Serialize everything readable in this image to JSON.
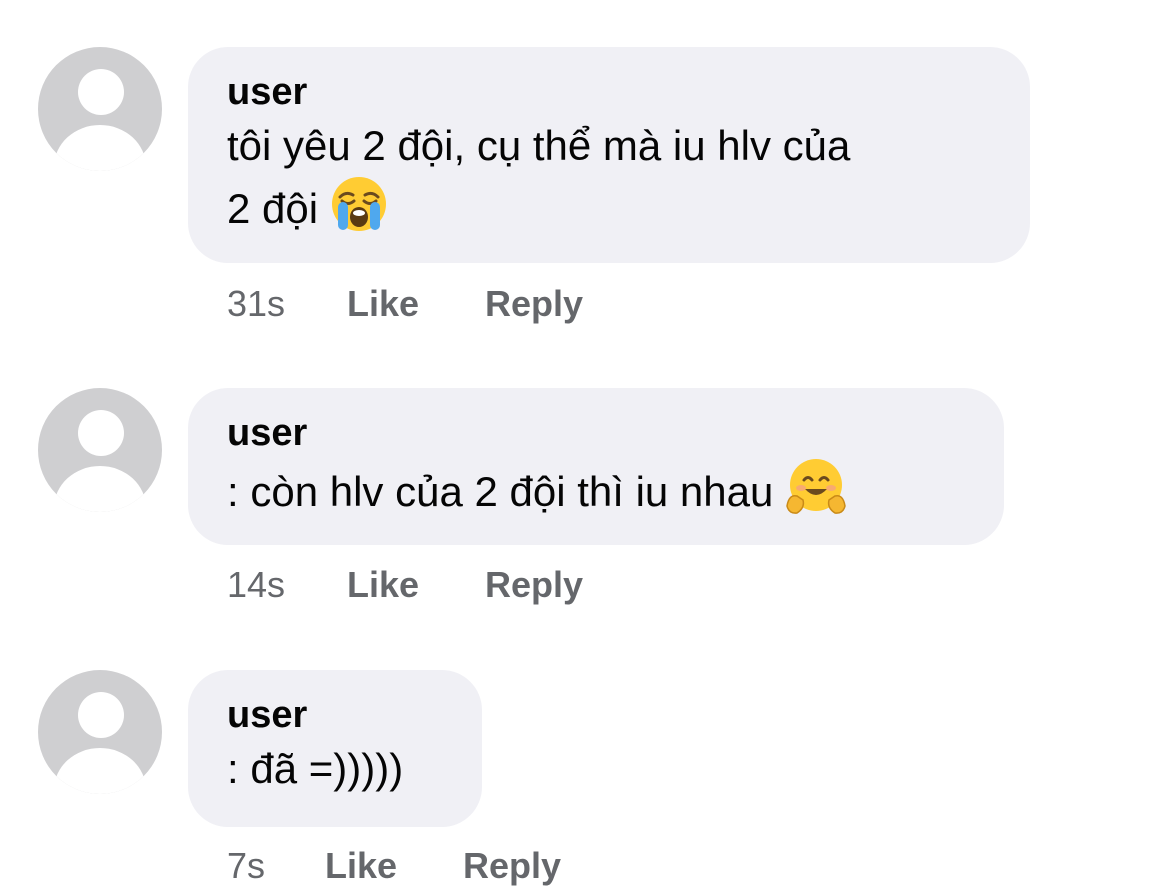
{
  "comments": [
    {
      "author": "user",
      "text_line1": "tôi yêu 2 đội, cụ thể mà iu hlv của",
      "text_line2": "2 đội",
      "emoji": "loudly-crying-face-icon",
      "time": "31s",
      "like_label": "Like",
      "reply_label": "Reply"
    },
    {
      "author": "user",
      "text": ": còn hlv của 2 đội thì iu nhau",
      "emoji": "hugging-face-icon",
      "time": "14s",
      "like_label": "Like",
      "reply_label": "Reply"
    },
    {
      "author": "user",
      "text": ": đã =)))))",
      "time": "7s",
      "like_label": "Like",
      "reply_label": "Reply"
    }
  ],
  "colors": {
    "bubble": "#f0f0f5",
    "avatar": "#cfcfd1",
    "meta_text": "#65676b",
    "main_text": "#050505"
  }
}
